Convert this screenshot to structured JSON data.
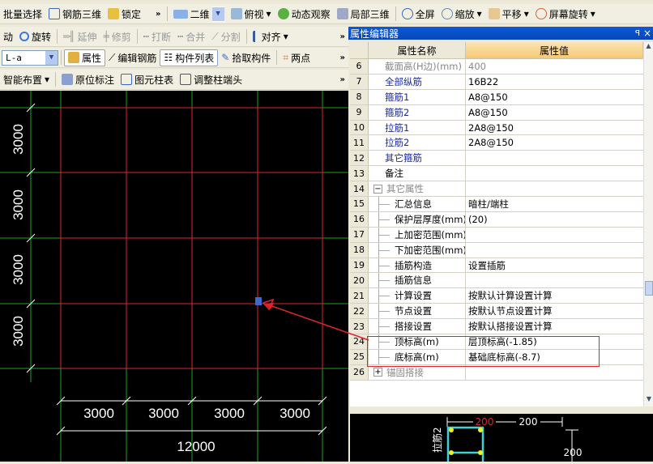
{
  "toolbar1": {
    "items": [
      "批量选择",
      "钢筋三维",
      "锁定"
    ],
    "view_combo": "二维",
    "items2": [
      "俯视",
      "动态观察",
      "局部三维",
      "全屏",
      "缩放",
      "平移",
      "屏幕旋转"
    ]
  },
  "toolbar2": {
    "items": [
      "动",
      "旋转",
      "延伸",
      "修剪",
      "打断",
      "合并",
      "分割",
      "对齐"
    ]
  },
  "toolbar3": {
    "combo": "L-a",
    "items": [
      "属性",
      "编辑钢筋",
      "构件列表",
      "拾取构件",
      "两点"
    ]
  },
  "toolbar4": {
    "items": [
      "智能布置",
      "原位标注",
      "图元柱表",
      "调整柱端头"
    ]
  },
  "more": "»",
  "panel": {
    "title": "属性编辑器",
    "pin": "ꟼ",
    "close": "×",
    "headers": [
      "属性名称",
      "属性值"
    ],
    "rows": [
      {
        "n": "6",
        "name": "截面高(H边)(mm)",
        "value": "400",
        "style": "gray"
      },
      {
        "n": "7",
        "name": "全部纵筋",
        "value": "16B22",
        "style": "blue"
      },
      {
        "n": "8",
        "name": "箍筋1",
        "value": "A8@150",
        "style": "blue"
      },
      {
        "n": "9",
        "name": "箍筋2",
        "value": "A8@150",
        "style": "blue"
      },
      {
        "n": "10",
        "name": "拉筋1",
        "value": "2A8@150",
        "style": "blue"
      },
      {
        "n": "11",
        "name": "拉筋2",
        "value": "2A8@150",
        "style": "blue"
      },
      {
        "n": "12",
        "name": "其它箍筋",
        "value": "",
        "style": "blue"
      },
      {
        "n": "13",
        "name": "备注",
        "value": "",
        "style": "plain"
      },
      {
        "n": "14",
        "name": "其它属性",
        "value": "",
        "style": "group-open"
      },
      {
        "n": "15",
        "name": "汇总信息",
        "value": "暗柱/端柱",
        "style": "sub"
      },
      {
        "n": "16",
        "name": "保护层厚度(mm)",
        "value": "(20)",
        "style": "sub"
      },
      {
        "n": "17",
        "name": "上加密范围(mm)",
        "value": "",
        "style": "sub"
      },
      {
        "n": "18",
        "name": "下加密范围(mm)",
        "value": "",
        "style": "sub"
      },
      {
        "n": "19",
        "name": "插筋构造",
        "value": "设置插筋",
        "style": "sub"
      },
      {
        "n": "20",
        "name": "插筋信息",
        "value": "",
        "style": "sub"
      },
      {
        "n": "21",
        "name": "计算设置",
        "value": "按默认计算设置计算",
        "style": "sub"
      },
      {
        "n": "22",
        "name": "节点设置",
        "value": "按默认节点设置计算",
        "style": "sub"
      },
      {
        "n": "23",
        "name": "搭接设置",
        "value": "按默认搭接设置计算",
        "style": "sub"
      },
      {
        "n": "24",
        "name": "顶标高(m)",
        "value": "层顶标高(-1.85)",
        "style": "sub"
      },
      {
        "n": "25",
        "name": "底标高(m)",
        "value": "基础底标高(-8.7)",
        "style": "sub"
      },
      {
        "n": "26",
        "name": "锚固搭接",
        "value": "",
        "style": "group-closed"
      }
    ]
  },
  "drawing": {
    "row_dims": [
      "3000",
      "3000",
      "3000",
      "3000"
    ],
    "col_dims": [
      "3000",
      "3000",
      "3000",
      "3000"
    ],
    "total": "12000"
  },
  "preview": {
    "dims": [
      "200",
      "200",
      "200"
    ],
    "label": "拉筋2"
  },
  "colors": {
    "grid_red": "#e0242c",
    "axis_green": "#1fa01f",
    "dim_white": "#ffffff",
    "rebar_cyan": "#3fd0d8",
    "rebar_yellow": "#f0f020",
    "title_blue": "#0a5ad8"
  }
}
